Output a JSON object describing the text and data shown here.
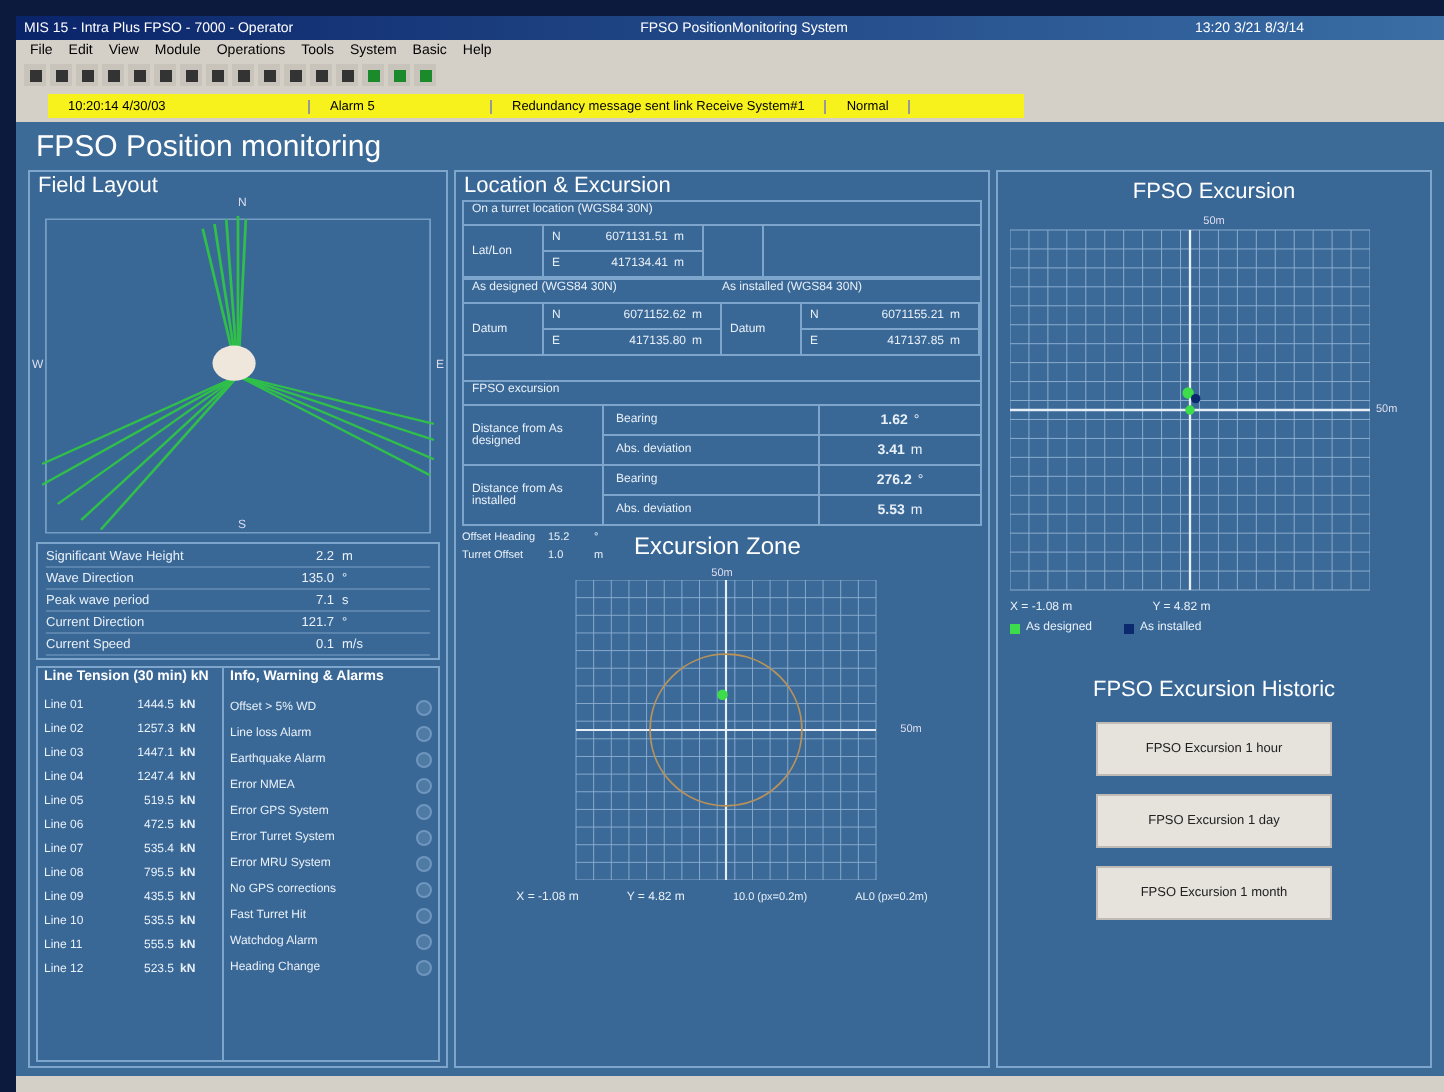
{
  "window": {
    "title": "MIS 15 - Intra Plus FPSO - 7000 - Operator",
    "center_title": "FPSO PositionMonitoring System",
    "clock": "13:20 3/21 8/3/14"
  },
  "menu": [
    "File",
    "Edit",
    "View",
    "Module",
    "Operations",
    "Tools",
    "System",
    "Basic",
    "Help"
  ],
  "alarm_bar": {
    "cells": [
      "10:20:14 4/30/03",
      "Alarm 5",
      "Redundancy message sent link Receive System#1",
      "Normal"
    ]
  },
  "page_title": "FPSO Position monitoring",
  "field_layout": {
    "title": "Field Layout",
    "compass": {
      "top": "N",
      "left": "W",
      "right": "E",
      "bottom": "S"
    }
  },
  "environment": [
    {
      "label": "Significant Wave Height",
      "value": "2.2",
      "unit": "m"
    },
    {
      "label": "Wave Direction",
      "value": "135.0",
      "unit": "°"
    },
    {
      "label": "Peak wave period",
      "value": "7.1",
      "unit": "s"
    },
    {
      "label": "Current Direction",
      "value": "121.7",
      "unit": "°"
    },
    {
      "label": "Current Speed",
      "value": "0.1",
      "unit": "m/s"
    }
  ],
  "line_tension": {
    "title": "Line Tension (30 min) kN",
    "rows": [
      {
        "line": "Line 01",
        "value": "1444.5",
        "unit": "kN"
      },
      {
        "line": "Line 02",
        "value": "1257.3",
        "unit": "kN"
      },
      {
        "line": "Line 03",
        "value": "1447.1",
        "unit": "kN"
      },
      {
        "line": "Line 04",
        "value": "1247.4",
        "unit": "kN"
      },
      {
        "line": "Line 05",
        "value": "519.5",
        "unit": "kN"
      },
      {
        "line": "Line 06",
        "value": "472.5",
        "unit": "kN"
      },
      {
        "line": "Line 07",
        "value": "535.4",
        "unit": "kN"
      },
      {
        "line": "Line 08",
        "value": "795.5",
        "unit": "kN"
      },
      {
        "line": "Line 09",
        "value": "435.5",
        "unit": "kN"
      },
      {
        "line": "Line 10",
        "value": "535.5",
        "unit": "kN"
      },
      {
        "line": "Line 11",
        "value": "555.5",
        "unit": "kN"
      },
      {
        "line": "Line 12",
        "value": "523.5",
        "unit": "kN"
      }
    ]
  },
  "alarms": {
    "title": "Info, Warning & Alarms",
    "items": [
      {
        "label": "Offset > 5% WD",
        "active": false
      },
      {
        "label": "Line loss Alarm",
        "active": false
      },
      {
        "label": "Earthquake Alarm",
        "active": false
      },
      {
        "label": "Error NMEA",
        "active": false
      },
      {
        "label": "Error GPS System",
        "active": false
      },
      {
        "label": "Error Turret System",
        "active": false
      },
      {
        "label": "Error MRU System",
        "active": false
      },
      {
        "label": "No GPS corrections",
        "active": false
      },
      {
        "label": "Fast Turret Hit",
        "active": false
      },
      {
        "label": "Watchdog Alarm",
        "active": false
      },
      {
        "label": "Heading Change",
        "active": false
      }
    ]
  },
  "location": {
    "title": "Location & Excursion",
    "turret_header": "On a turret location (WGS84 30N)",
    "turret_label": "Lat/Lon",
    "turret_n": {
      "axis": "N",
      "value": "6071131.51",
      "unit": "m"
    },
    "turret_e": {
      "axis": "E",
      "value": "417134.41",
      "unit": "m"
    },
    "datums": [
      {
        "header": "As designed (WGS84 30N)",
        "label": "Datum",
        "n": {
          "axis": "N",
          "value": "6071152.62",
          "unit": "m"
        },
        "e": {
          "axis": "E",
          "value": "417135.80",
          "unit": "m"
        }
      },
      {
        "header": "As installed (WGS84 30N)",
        "label": "Datum",
        "n": {
          "axis": "N",
          "value": "6071155.21",
          "unit": "m"
        },
        "e": {
          "axis": "E",
          "value": "417137.85",
          "unit": "m"
        }
      }
    ],
    "excursion_header": "FPSO excursion",
    "distances": [
      {
        "label": "Distance from As designed",
        "rows": [
          {
            "label": "Bearing",
            "value": "1.62",
            "unit": "°"
          },
          {
            "label": "Abs. deviation",
            "value": "3.41",
            "unit": "m"
          }
        ]
      },
      {
        "label": "Distance from As installed",
        "rows": [
          {
            "label": "Bearing",
            "value": "276.2",
            "unit": "°"
          },
          {
            "label": "Abs. deviation",
            "value": "5.53",
            "unit": "m"
          }
        ]
      }
    ]
  },
  "offsets": [
    {
      "label": "Offset Heading",
      "value": "15.2",
      "unit": "°"
    },
    {
      "label": "Turret Offset",
      "value": "1.0",
      "unit": "m"
    }
  ],
  "excursion_zone": {
    "title": "Excursion Zone",
    "top_label": "50m",
    "right_label": "50m",
    "x": "X = -1.08 m",
    "y": "Y = 4.82 m",
    "scale_1": "10.0 (px=0.2m)",
    "scale_2": "AL0 (px=0.2m)"
  },
  "fpso_excursion": {
    "title": "FPSO Excursion",
    "top_label": "50m",
    "right_label": "50m",
    "x": "X = -1.08 m",
    "y": "Y = 4.82 m",
    "legend": [
      {
        "label": "As designed",
        "color": "#3ddc4a"
      },
      {
        "label": "As installed",
        "color": "#0b2a6e"
      }
    ]
  },
  "historic": {
    "title": "FPSO Excursion Historic",
    "buttons": [
      "FPSO Excursion 1 hour",
      "FPSO Excursion 1 day",
      "FPSO Excursion 1 month"
    ]
  }
}
